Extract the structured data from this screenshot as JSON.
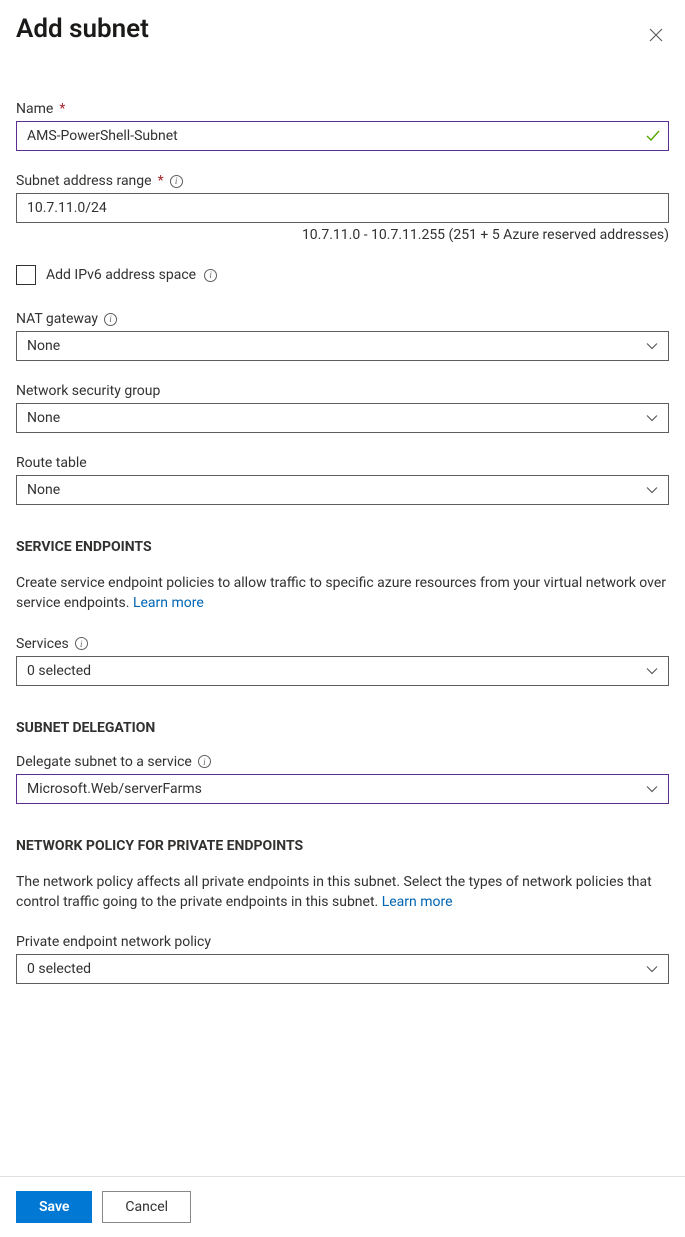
{
  "header": {
    "title": "Add subnet"
  },
  "fields": {
    "name": {
      "label": "Name",
      "value": "AMS-PowerShell-Subnet"
    },
    "subnet_range": {
      "label": "Subnet address range",
      "value": "10.7.11.0/24",
      "help": "10.7.11.0 - 10.7.11.255 (251 + 5 Azure reserved addresses)"
    },
    "ipv6": {
      "label": "Add IPv6 address space"
    },
    "nat_gateway": {
      "label": "NAT gateway",
      "value": "None"
    },
    "nsg": {
      "label": "Network security group",
      "value": "None"
    },
    "route_table": {
      "label": "Route table",
      "value": "None"
    }
  },
  "service_endpoints": {
    "header": "SERVICE ENDPOINTS",
    "desc": "Create service endpoint policies to allow traffic to specific azure resources from your virtual network over service endpoints. ",
    "learn_more": "Learn more",
    "services_label": "Services",
    "services_value": "0 selected"
  },
  "subnet_delegation": {
    "header": "SUBNET DELEGATION",
    "label": "Delegate subnet to a service",
    "value": "Microsoft.Web/serverFarms"
  },
  "network_policy": {
    "header": "NETWORK POLICY FOR PRIVATE ENDPOINTS",
    "desc": "The network policy affects all private endpoints in this subnet. Select the types of network policies that control traffic going to the private endpoints in this subnet. ",
    "learn_more": "Learn more",
    "label": "Private endpoint network policy",
    "value": "0 selected"
  },
  "footer": {
    "save": "Save",
    "cancel": "Cancel"
  }
}
